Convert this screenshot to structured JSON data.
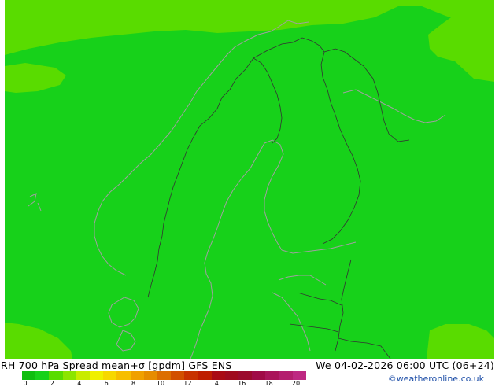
{
  "title": {
    "product": "RH 700 hPa Spread mean+σ [gpdm] GFS ENS",
    "valid_time": "We 04-02-2026 06:00 UTC (06+24)"
  },
  "map": {
    "region": "Scandinavia, Finland, Baltic Sea",
    "base_color": "#17d11a",
    "low_spread_color": "#59dc00"
  },
  "colorbar": {
    "colors": [
      "#0fbe0f",
      "#17d11a",
      "#59dc00",
      "#8ce500",
      "#c8ec00",
      "#f0f000",
      "#f7d800",
      "#f7be00",
      "#f0a000",
      "#e68c00",
      "#dc6e00",
      "#d25000",
      "#c83200",
      "#be1e00",
      "#aa0a14",
      "#a00a1e",
      "#9b0a2d",
      "#a00a46",
      "#aa145a",
      "#b41e6e",
      "#be2882"
    ],
    "tick_labels": [
      "0",
      "2",
      "4",
      "6",
      "8",
      "10",
      "12",
      "14",
      "16",
      "18",
      "20"
    ]
  },
  "credit": "©weatheronline.co.uk"
}
